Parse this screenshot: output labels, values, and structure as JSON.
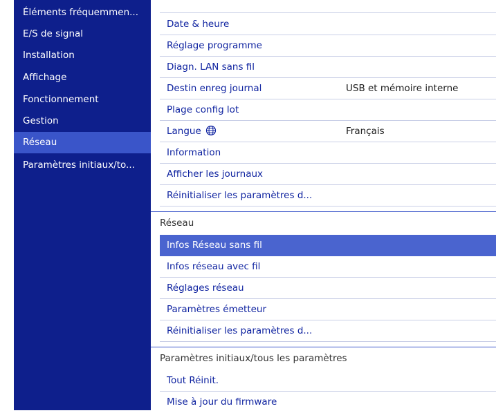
{
  "sidebar": {
    "items": [
      {
        "label": "Éléments fréquemmen..."
      },
      {
        "label": "E/S de signal"
      },
      {
        "label": "Installation"
      },
      {
        "label": "Affichage"
      },
      {
        "label": "Fonctionnement"
      },
      {
        "label": "Gestion"
      },
      {
        "label": "Réseau",
        "selected": true
      },
      {
        "label": "Paramètres initiaux/to..."
      }
    ]
  },
  "menu": {
    "rows1": [
      {
        "label": "Date & heure"
      },
      {
        "label": "Réglage programme"
      },
      {
        "label": "Diagn. LAN sans fil"
      },
      {
        "label": "Destin enreg journal",
        "value": "USB et mémoire interne"
      },
      {
        "label": "Plage config lot"
      },
      {
        "label": "Langue",
        "icon": "globe-icon",
        "value": "Français"
      },
      {
        "label": "Information"
      },
      {
        "label": "Afficher les journaux"
      },
      {
        "label": "Réinitialiser les paramètres d..."
      }
    ],
    "group2": {
      "header": "Réseau",
      "rows": [
        {
          "label": "Infos Réseau sans fil",
          "selected": true
        },
        {
          "label": "Infos réseau avec fil"
        },
        {
          "label": "Réglages réseau"
        },
        {
          "label": "Paramètres émetteur"
        },
        {
          "label": "Réinitialiser les paramètres d..."
        }
      ]
    },
    "group3": {
      "header": "Paramètres initiaux/tous les paramètres",
      "rows": [
        {
          "label": "Tout Réinit."
        },
        {
          "label": "Mise à jour du firmware"
        }
      ]
    }
  },
  "colors": {
    "sidebar_bg": "#0e1f8c",
    "selected_bg": "#3a55c9",
    "menu_text": "#0f23a0"
  }
}
